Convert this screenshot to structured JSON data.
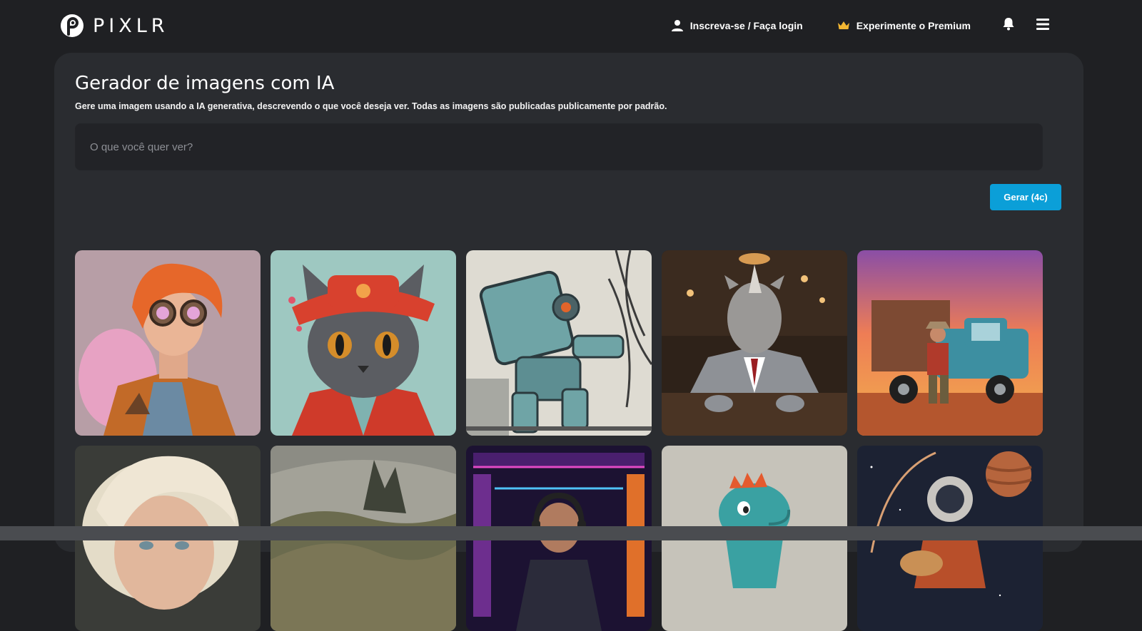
{
  "header": {
    "brand": "PIXLR",
    "login_label": "Inscreva-se / Faça login",
    "premium_label": "Experimente o Premium",
    "icons": [
      "user-icon",
      "crown-icon",
      "bell-icon",
      "menu-icon"
    ]
  },
  "main": {
    "title": "Gerador de imagens com IA",
    "subtitle": "Gere uma imagem usando a IA generativa, descrevendo o que você deseja ver. Todas as imagens são publicadas publicamente por padrão.",
    "prompt": {
      "value": "",
      "placeholder": "O que você quer ver?"
    },
    "generate_label": "Gerar (4c)"
  },
  "colors": {
    "background": "#1f2023",
    "card": "#2a2c30",
    "input": "#222327",
    "accent": "#0b9fd8",
    "crown": "#f2b632"
  },
  "gallery": {
    "items": [
      {
        "subject": "steampunk-goggles-portrait"
      },
      {
        "subject": "cat-in-red-hat"
      },
      {
        "subject": "robot-sketch"
      },
      {
        "subject": "rhino-in-suit"
      },
      {
        "subject": "man-with-truck-sunset"
      },
      {
        "subject": "blonde-woman-portrait"
      },
      {
        "subject": "mountain-landscape"
      },
      {
        "subject": "gamer-neon-room"
      },
      {
        "subject": "dinosaur-toy"
      },
      {
        "subject": "astronaut-guitar-space"
      }
    ]
  }
}
